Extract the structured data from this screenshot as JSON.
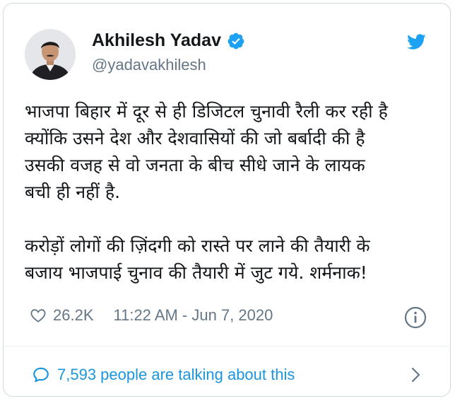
{
  "tweet": {
    "author": {
      "name": "Akhilesh Yadav",
      "handle": "@yadavakhilesh",
      "verified": true
    },
    "paragraphs": [
      [
        "भाजपा बिहार में दूर से ही डिजिटल चुनावी रैली कर रही है",
        "क्योंकि उसने देश और देशवासियों की जो बर्बादी की है",
        "उसकी वजह से वो जनता के बीच सीधे जाने के लायक",
        "बची ही नहीं है."
      ],
      [
        "करोड़ों लोगों की ज़िंदगी को रास्ते पर लाने की तैयारी के",
        "बजाय भाजपाई चुनाव की तैयारी में जुट गये. शर्मनाक!"
      ]
    ],
    "likes": "26.2K",
    "timestamp": "11:22 AM - Jun 7, 2020",
    "talking_about": "7,593 people are talking about this"
  },
  "icons": {
    "verified": "verified-badge-icon",
    "brand": "twitter-bird-icon",
    "like": "heart-icon",
    "info": "info-icon",
    "reply": "speech-bubble-icon",
    "chevron": "chevron-right-icon"
  },
  "colors": {
    "brand_blue": "#1da1f2",
    "link_blue": "#1b95e0",
    "muted_text": "#657786",
    "primary_text": "#14171a",
    "border": "#cfd9de"
  }
}
